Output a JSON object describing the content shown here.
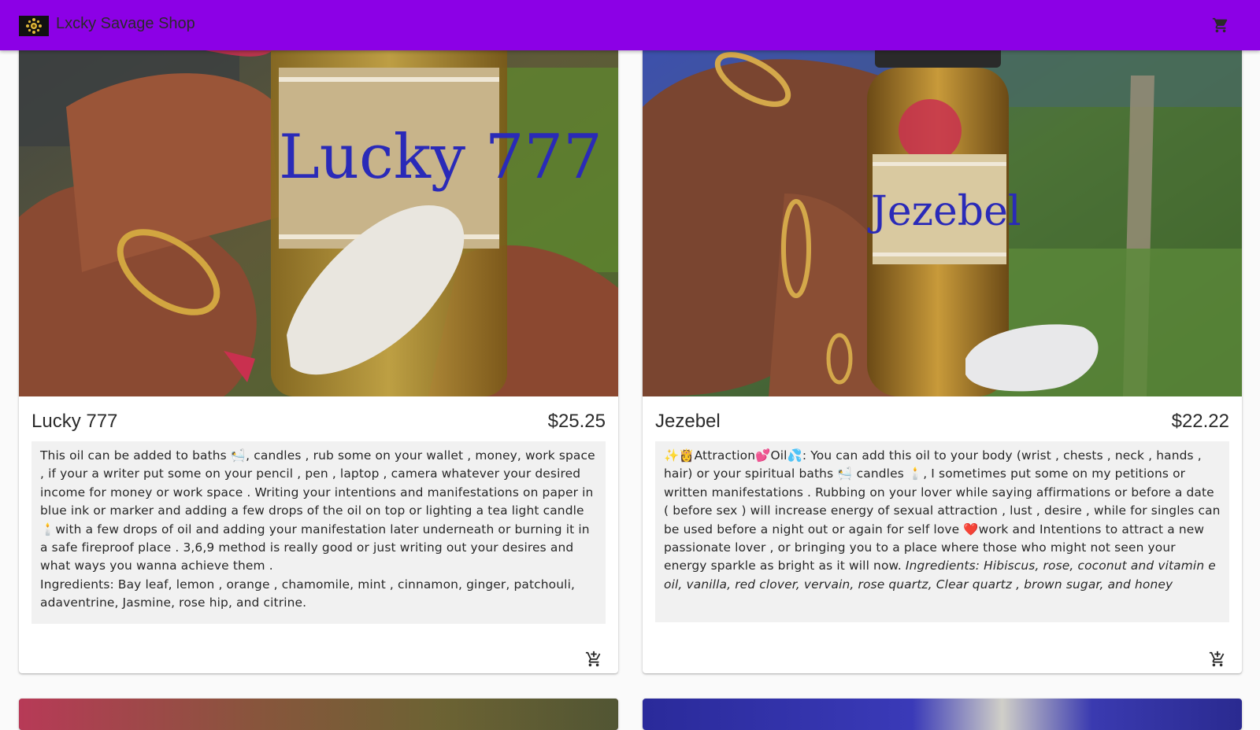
{
  "app": {
    "title": "Lxcky Savage Shop",
    "brand_color": "#8c00e6",
    "logo_icon": "sun-emblem-icon",
    "cart_icon": "shopping-cart-icon"
  },
  "products": [
    {
      "name": "Lucky 777",
      "price": "$25.25",
      "image_label": "Lucky 777",
      "description": "This oil can be added to baths 🛀, candles , rub some on your wallet , money, work space , if your a writer put  some on your pencil , pen , laptop , camera whatever your desired income for money or work space . Writing your intentions and manifestations on paper in blue ink or marker and adding a few drops of the oil on top or lighting a tea light candle 🕯️with a few drops of oil and adding your manifestation later underneath or burning it in a safe fireproof place . 3,6,9 method is really good or just writing out your desires and what ways you wanna achieve them .",
      "ingredients": "Ingredients: Bay leaf, lemon , orange , chamomile, mint , cinnamon, ginger, patchouli, adaventrine, Jasmine, rose hip, and citrine.",
      "add_to_cart_icon": "add-shopping-cart-icon"
    },
    {
      "name": "Jezebel",
      "price": "$22.22",
      "image_label": "Jezebel",
      "description": "✨👸Attraction💕Oil💦: You can add this oil to your body (wrist , chests , neck , hands , hair) or your spiritual baths 🛀 candles 🕯️, I sometimes put some on my petitions or written manifestations . Rubbing on your lover while saying affirmations or before a date ( before sex ) will increase energy of sexual attraction , lust , desire , while for singles can be used before a night out or again for self love ❤️work and Intentions to attract a new passionate lover , or bringing you to a place where those who might not seen your energy sparkle as bright as it will now. ",
      "ingredients": "Ingredients: Hibiscus, rose, coconut and vitamin e oil, vanilla, red clover, vervain, rose quartz, Clear quartz , brown sugar, and honey",
      "add_to_cart_icon": "add-shopping-cart-icon"
    }
  ]
}
